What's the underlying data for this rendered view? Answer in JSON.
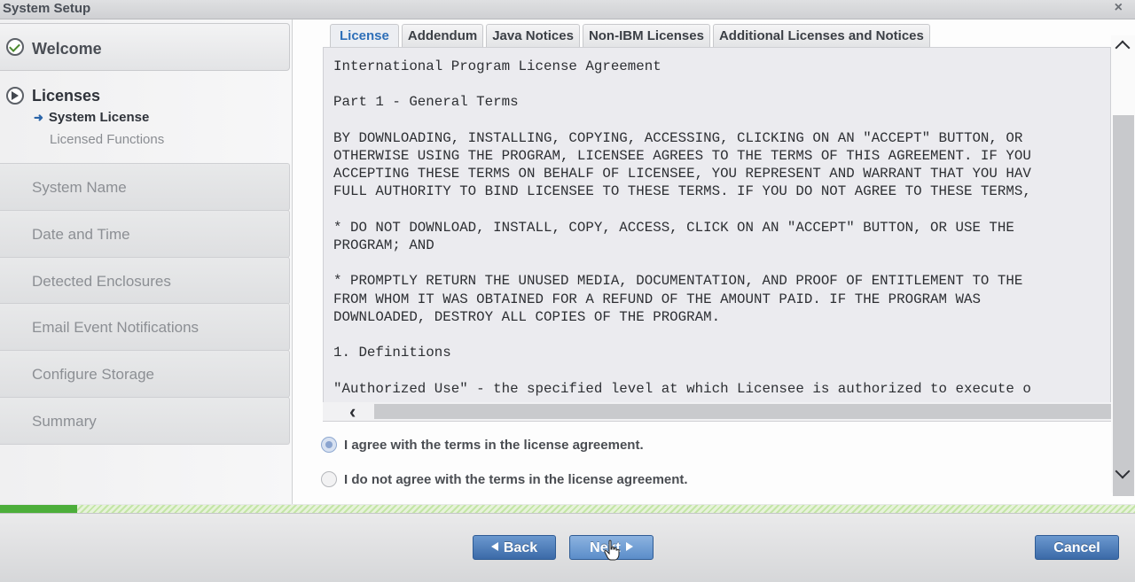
{
  "window": {
    "title": "System Setup",
    "close_glyph": "×"
  },
  "sidebar": {
    "welcome": "Welcome",
    "licenses": "Licenses",
    "sub_current": "System License",
    "sub_next": "Licensed Functions",
    "steps": [
      "System Name",
      "Date and Time",
      "Detected Enclosures",
      "Email Event Notifications",
      "Configure Storage",
      "Summary"
    ]
  },
  "tabs": [
    "License",
    "Addendum",
    "Java Notices",
    "Non-IBM Licenses",
    "Additional Licenses and Notices"
  ],
  "license_text": "International Program License Agreement\n\nPart 1 - General Terms\n\nBY DOWNLOADING, INSTALLING, COPYING, ACCESSING, CLICKING ON AN \"ACCEPT\" BUTTON, OR\nOTHERWISE USING THE PROGRAM, LICENSEE AGREES TO THE TERMS OF THIS AGREEMENT. IF YOU\nACCEPTING THESE TERMS ON BEHALF OF LICENSEE, YOU REPRESENT AND WARRANT THAT YOU HAV\nFULL AUTHORITY TO BIND LICENSEE TO THESE TERMS. IF YOU DO NOT AGREE TO THESE TERMS,\n\n* DO NOT DOWNLOAD, INSTALL, COPY, ACCESS, CLICK ON AN \"ACCEPT\" BUTTON, OR USE THE\nPROGRAM; AND\n\n* PROMPTLY RETURN THE UNUSED MEDIA, DOCUMENTATION, AND PROOF OF ENTITLEMENT TO THE\nFROM WHOM IT WAS OBTAINED FOR A REFUND OF THE AMOUNT PAID. IF THE PROGRAM WAS\nDOWNLOADED, DESTROY ALL COPIES OF THE PROGRAM.\n\n1. Definitions\n\n\"Authorized Use\" - the specified level at which Licensee is authorized to execute o",
  "agreement": {
    "agree": "I agree with the terms in the license agreement.",
    "disagree": "I do not agree with the terms in the license agreement.",
    "selected": "agree"
  },
  "progress": {
    "fraction": 0.068
  },
  "footer": {
    "back": "Back",
    "next": "Next",
    "cancel": "Cancel"
  },
  "icons": {
    "welcome": "check-circle-icon",
    "licenses": "current-step-arrow-icon",
    "sub_arrow": "arrow-right-icon",
    "scroll_left": "chevron-left-icon",
    "scroll_up": "chevron-up-icon",
    "scroll_down": "chevron-down-icon",
    "cursor": "hand-pointer-icon"
  },
  "colors": {
    "accent": "#2e6fb8",
    "progress": "#4cae3a",
    "button": "#3b6aa8"
  }
}
